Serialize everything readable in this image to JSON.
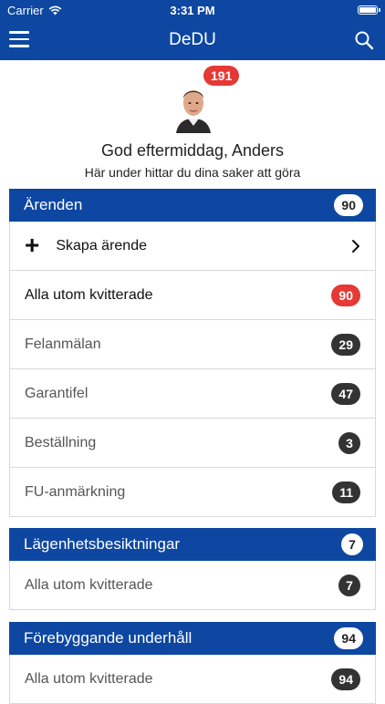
{
  "status_bar": {
    "carrier": "Carrier",
    "time": "3:31 PM"
  },
  "nav": {
    "title": "DeDU"
  },
  "profile": {
    "notification_count": "191",
    "greeting": "God eftermiddag, Anders",
    "subtitle": "Här under hittar du dina saker att göra"
  },
  "arenden": {
    "title": "Ärenden",
    "count": "90",
    "create_label": "Skapa ärende",
    "rows": [
      {
        "label": "Alla utom kvitterade",
        "count": "90"
      },
      {
        "label": "Felanmälan",
        "count": "29"
      },
      {
        "label": "Garantifel",
        "count": "47"
      },
      {
        "label": "Beställning",
        "count": "3"
      },
      {
        "label": "FU-anmärkning",
        "count": "11"
      }
    ]
  },
  "besiktningar": {
    "title": "Lägenhetsbesiktningar",
    "count": "7",
    "rows": [
      {
        "label": "Alla utom kvitterade",
        "count": "7"
      }
    ]
  },
  "underhall": {
    "title": "Förebyggande underhåll",
    "count": "94",
    "rows": [
      {
        "label": "Alla utom kvitterade",
        "count": "94"
      }
    ]
  },
  "colors": {
    "brand": "#0d47a1",
    "alert": "#e53935",
    "pill_dark": "#333333"
  }
}
